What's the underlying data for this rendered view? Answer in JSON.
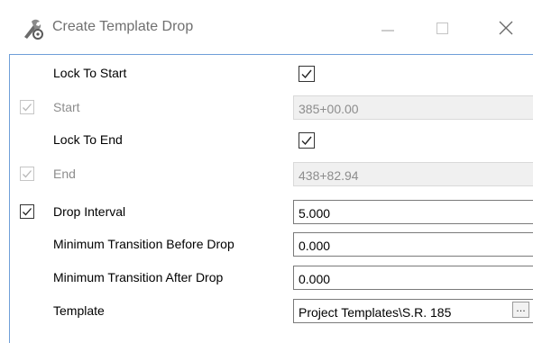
{
  "window": {
    "title": "Create Template Drop",
    "icon": "template-wrench-icon",
    "controls": [
      "minimize-icon",
      "maximize-icon",
      "close-icon"
    ]
  },
  "rows": [
    {
      "label": "Lock To Start",
      "enabled": true,
      "value_type": "checkbox",
      "checked": true
    },
    {
      "label": "Start",
      "enabled": false,
      "row_checkbox": true,
      "row_checked": true,
      "value_type": "text",
      "value": "385+00.00"
    },
    {
      "label": "Lock To End",
      "enabled": true,
      "value_type": "checkbox",
      "checked": true
    },
    {
      "label": "End",
      "enabled": false,
      "row_checkbox": true,
      "row_checked": true,
      "value_type": "text",
      "value": "438+82.94"
    },
    {
      "label": "Drop Interval",
      "enabled": true,
      "row_checkbox": true,
      "row_checked": true,
      "value_type": "text",
      "value": "5.000"
    },
    {
      "label": "Minimum Transition Before Drop",
      "enabled": true,
      "value_type": "text",
      "value": "0.000"
    },
    {
      "label": "Minimum Transition After Drop",
      "enabled": true,
      "value_type": "text",
      "value": "0.000"
    },
    {
      "label": "Template",
      "enabled": true,
      "value_type": "text",
      "value": "Project Templates\\S.R. 185",
      "browse_label": "..."
    }
  ],
  "colors": {
    "accent_border": "#6f9fd8",
    "disabled_text": "#8d8d8d",
    "disabled_field": "#f0f0f0",
    "title_text": "#707070"
  }
}
